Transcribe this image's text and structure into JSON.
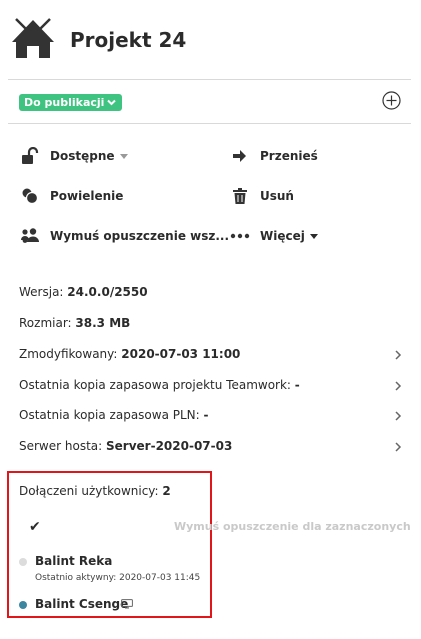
{
  "project": {
    "title": "Projekt 24",
    "icon": "house-icon"
  },
  "status": {
    "label": "Do publikacji",
    "color": "#3fc380"
  },
  "add_button": {
    "icon": "plus-circle-icon"
  },
  "actions": {
    "available": {
      "label": "Dostępne",
      "icon": "unlock-icon"
    },
    "move": {
      "label": "Przenieś",
      "icon": "arrow-right-icon"
    },
    "duplicate": {
      "label": "Powielenie",
      "icon": "duplicate-icon"
    },
    "delete": {
      "label": "Usuń",
      "icon": "trash-icon"
    },
    "force_leave_all": {
      "label": "Wymuś opuszczenie wsz...",
      "icon": "users-icon"
    },
    "more": {
      "label": "Więcej",
      "icon": "dots-icon"
    }
  },
  "info": {
    "version": {
      "label": "Wersja:",
      "value": "24.0.0/2550"
    },
    "size": {
      "label": "Rozmiar:",
      "value": "38.3 MB"
    },
    "modified": {
      "label": "Zmodyfikowany:",
      "value": "2020-07-03 11:00"
    },
    "teamwork_backup": {
      "label": "Ostatnia kopia zapasowa projektu Teamwork:",
      "value": "-"
    },
    "pln_backup": {
      "label": "Ostatnia kopia zapasowa PLN:",
      "value": "-"
    },
    "host_server": {
      "label": "Serwer hosta:",
      "value": "Server-2020-07-03"
    }
  },
  "users": {
    "title_label": "Dołączeni użytkownicy:",
    "count": "2",
    "force_leave_selected": "Wymuś opuszczenie dla zaznaczonych",
    "list": [
      {
        "name": "Balint Reka",
        "last_active": "Ostatnio aktywny: 2020-07-03 11:45",
        "status_color": "#dcdcdc"
      },
      {
        "name": "Balint Csenge",
        "status_color": "#3d86a0",
        "device_icon": "monitor-icon"
      }
    ]
  },
  "colors": {
    "highlight_border": "#e0161b"
  }
}
